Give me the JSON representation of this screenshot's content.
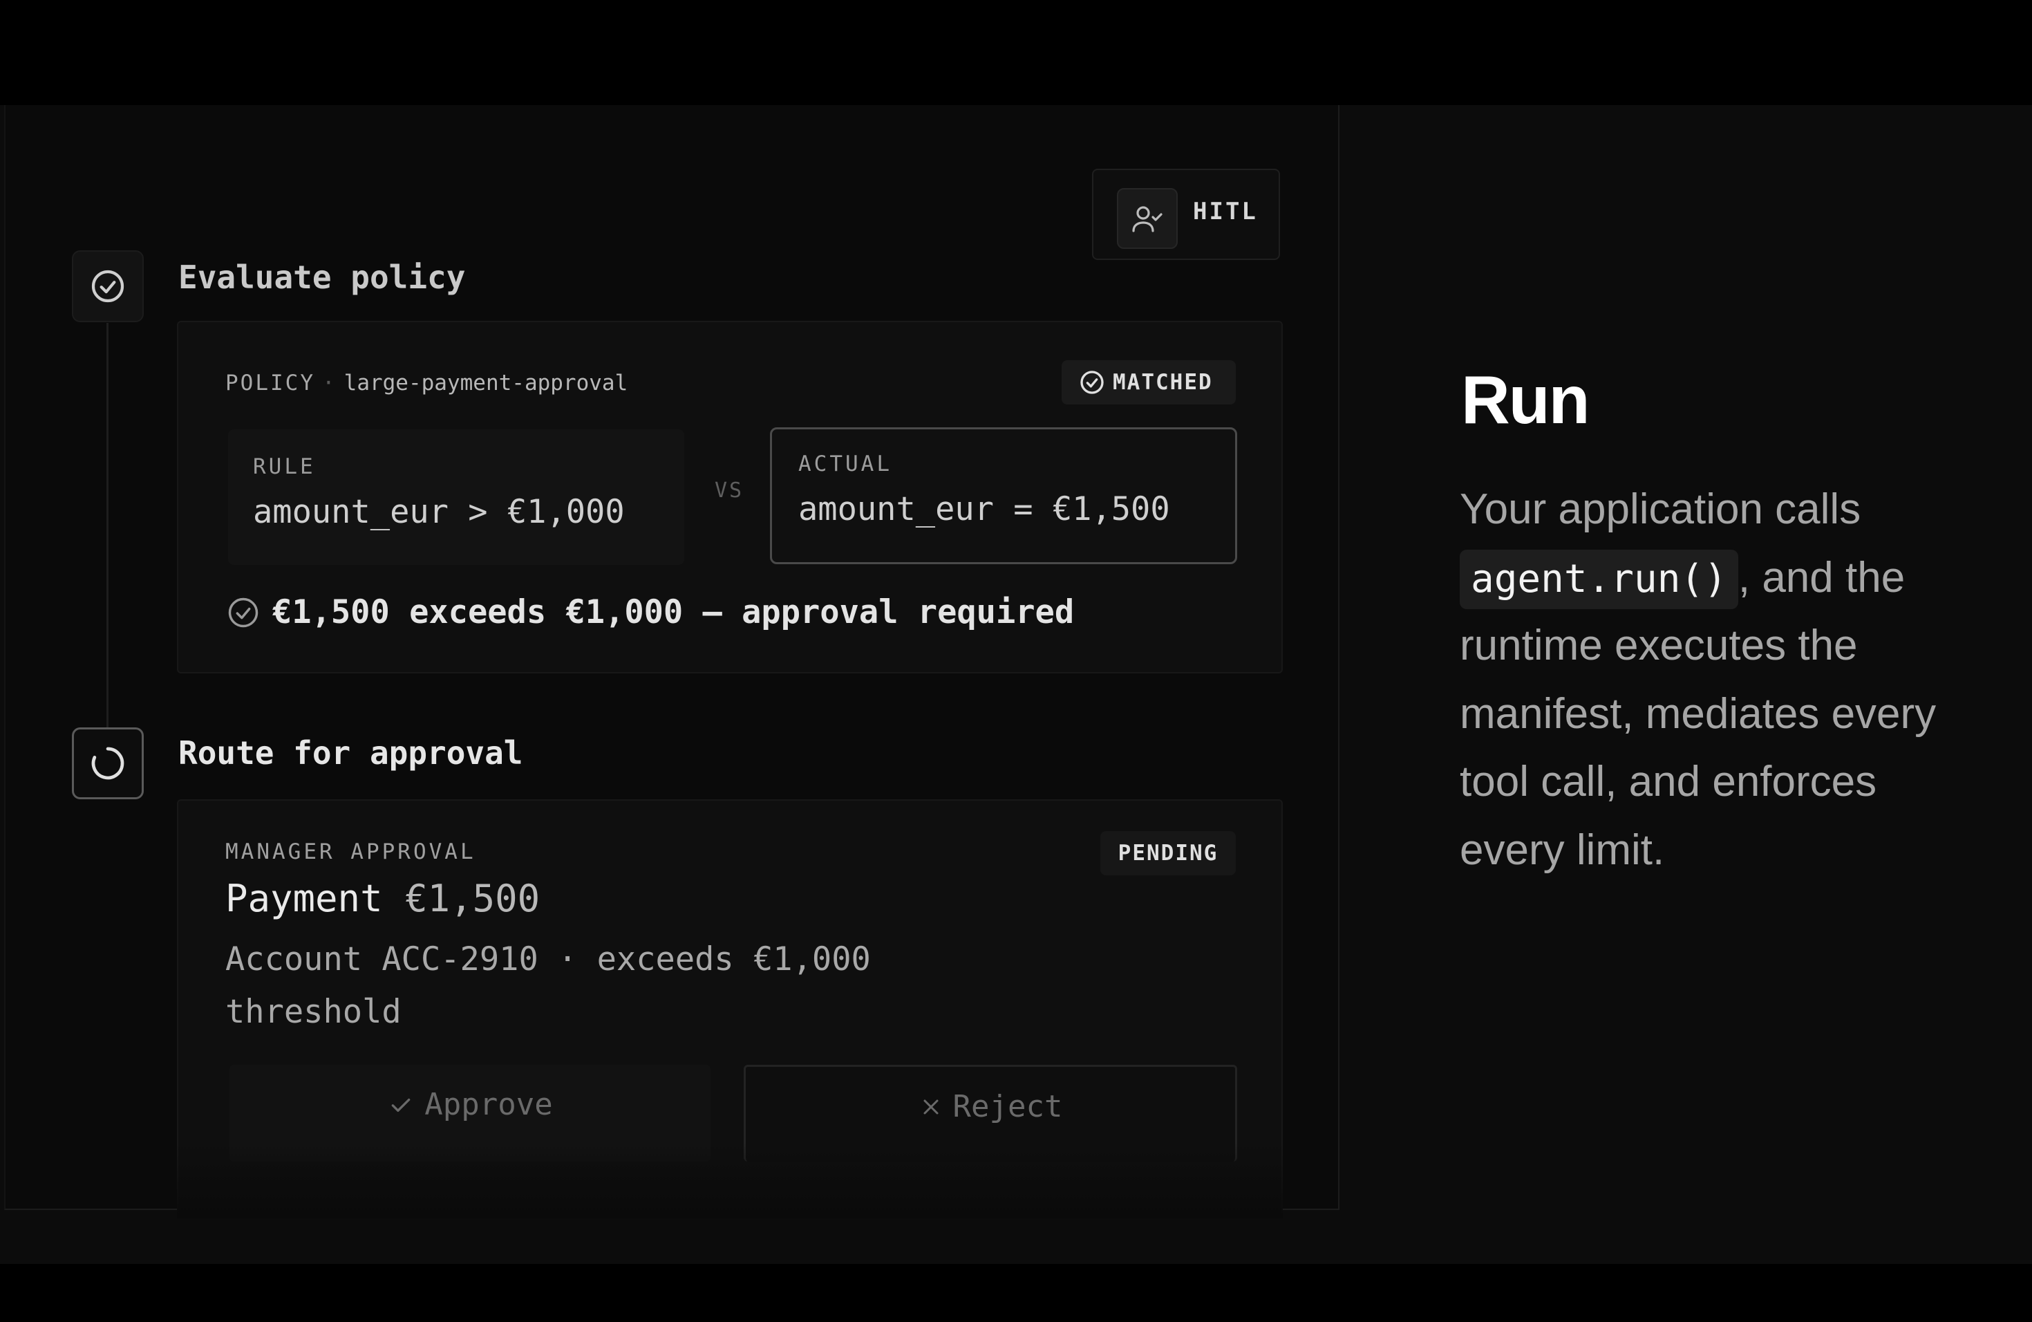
{
  "hitl_badge": {
    "label": "HITL",
    "icon": "user-check-icon"
  },
  "steps": [
    {
      "title": "Evaluate policy",
      "status_icon": "check-circle-icon",
      "policy": {
        "label": "POLICY",
        "separator": "·",
        "name": "large-payment-approval",
        "status": "MATCHED",
        "rule": {
          "label": "RULE",
          "expression": "amount_eur > €1,000"
        },
        "vs_label": "VS",
        "actual": {
          "label": "ACTUAL",
          "expression": "amount_eur = €1,500"
        },
        "result": "€1,500 exceeds €1,000 — approval required"
      }
    },
    {
      "title": "Route for approval",
      "status_icon": "spinner-icon",
      "approval": {
        "label": "MANAGER APPROVAL",
        "status": "PENDING",
        "title": "Payment",
        "amount": "€1,500",
        "description": "Account ACC-2910 · exceeds €1,000 threshold",
        "approve_label": "Approve",
        "reject_label": "Reject"
      }
    }
  ],
  "explainer": {
    "title": "Run",
    "text_before": "Your application calls",
    "code": "agent.run()",
    "text_after": ", and the runtime executes the manifest, mediates every tool call, and enforces every limit."
  }
}
